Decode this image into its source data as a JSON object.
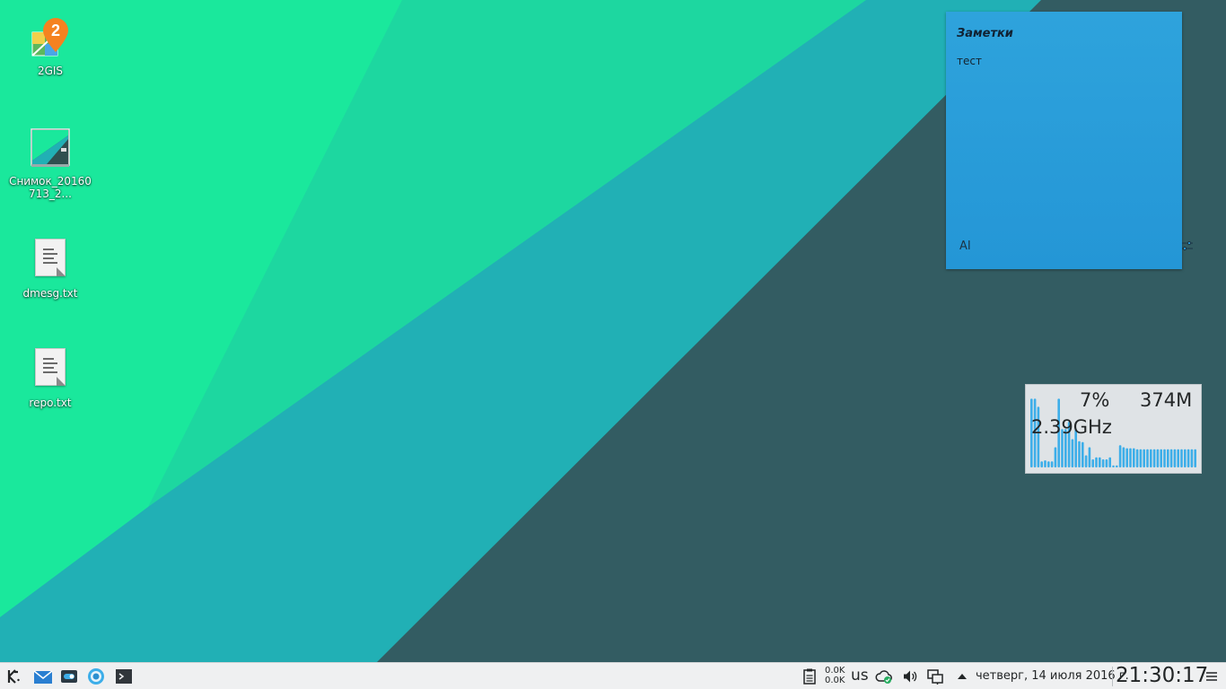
{
  "desktop": {
    "icons": [
      {
        "label": "2GIS",
        "icon": "2gis-app-icon"
      },
      {
        "label": "Снимок_20160713_2...",
        "icon": "screenshot-image-icon"
      },
      {
        "label": "dmesg.txt",
        "icon": "text-file-icon"
      },
      {
        "label": "repo.txt",
        "icon": "text-file-icon"
      }
    ],
    "badge": "2"
  },
  "notes_widget": {
    "title": "Заметки",
    "content": "тест",
    "format_glyph": "AI",
    "color": "#2a9ddb"
  },
  "system_monitor": {
    "cpu_percent": "7%",
    "memory": "374M",
    "cpu_freq": "2.39GHz",
    "bar_color": "#3daee9",
    "bar_levels": [
      0.68,
      0.68,
      0.6,
      0.06,
      0.07,
      0.06,
      0.06,
      0.2,
      0.68,
      0.38,
      0.38,
      0.45,
      0.28,
      0.38,
      0.26,
      0.25,
      0.12,
      0.2,
      0.08,
      0.1,
      0.1,
      0.08,
      0.08,
      0.1,
      0.02,
      0.02,
      0.22,
      0.2,
      0.19,
      0.19,
      0.19,
      0.18,
      0.18,
      0.18,
      0.18,
      0.18,
      0.18,
      0.18,
      0.18,
      0.18,
      0.18,
      0.18,
      0.18,
      0.18,
      0.18,
      0.18,
      0.18,
      0.18,
      0.18
    ]
  },
  "panel": {
    "launchers": [
      "kde-menu-icon",
      "mail-icon",
      "toggle-app-icon",
      "browser-icon",
      "terminal-icon"
    ],
    "net_up": "0.0K",
    "net_down": "0.0K",
    "keyboard_layout": "us",
    "date": "четверг, 14 июля 2016 г.",
    "time": "21:30:17"
  }
}
